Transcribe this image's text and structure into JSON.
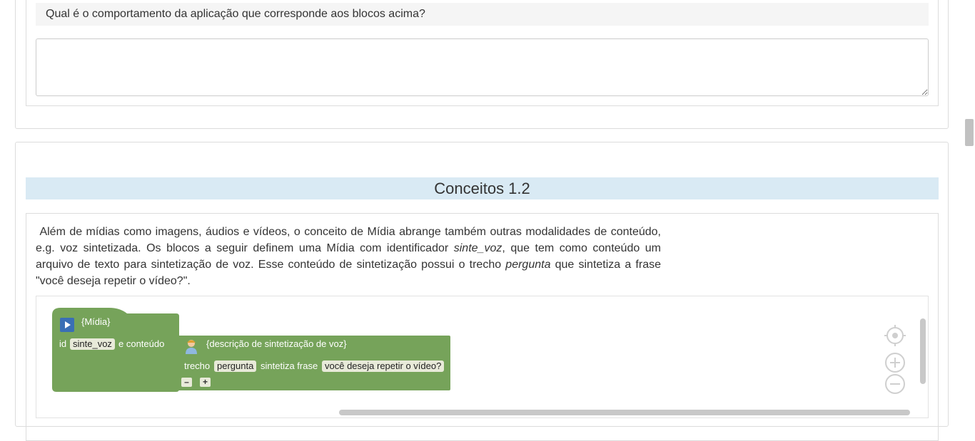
{
  "question": {
    "text": "Qual é o comportamento da aplicação que corresponde aos blocos acima?",
    "answer_value": ""
  },
  "section": {
    "title": "Conceitos 1.2"
  },
  "paragraph": {
    "part1": "Além de mídias como imagens, áudios e vídeos, o conceito de Mídia abrange também outras modalidades de conteúdo, e.g. voz sintetizada. Os blocos a seguir definem uma Mídia com identificador ",
    "em1": "sinte_voz",
    "part2": ", que tem como conteúdo um arquivo de texto para sintetização de voz. Esse conteúdo de sintetização possui o trecho ",
    "em2": "pergunta",
    "part3": " que sintetiza a frase \"você deseja repetir o vídeo?\"."
  },
  "blocks": {
    "media_label": "{Mídia}",
    "id_label": "id",
    "id_value": "sinte_voz",
    "content_label": "e conteúdo",
    "tts_label": "{descrição de sintetização de voz}",
    "trecho_label": "trecho",
    "trecho_value": "pergunta",
    "frase_label": "sintetiza frase",
    "frase_value": "você deseja repetir o vídeo?",
    "minus_label": "–",
    "plus_label": "+"
  },
  "icons": [
    "play-icon",
    "person-icon",
    "recenter-icon",
    "zoom-in-icon",
    "zoom-out-icon",
    "resize-grip-icon"
  ],
  "colors": {
    "block_green": "#76a35a",
    "title_band": "#d9eaf4",
    "field_bg": "#e8ead9"
  }
}
